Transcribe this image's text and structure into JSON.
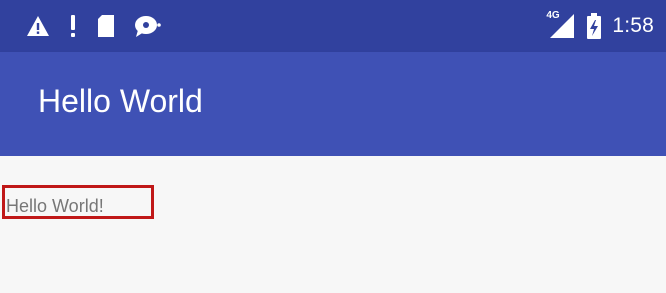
{
  "status_bar": {
    "time": "1:58",
    "network_label": "4G",
    "icons": [
      "warning-triangle-icon",
      "exclamation-icon",
      "sd-card-icon",
      "chat-bubble-icon",
      "cellular-signal-icon",
      "battery-icon"
    ]
  },
  "toolbar": {
    "title": "Hello World"
  },
  "content": {
    "text": "Hello World!"
  },
  "colors": {
    "status_bar": "#31419e",
    "toolbar": "#3f51b5",
    "highlight_border": "#c01818",
    "background": "#f7f7f7"
  }
}
